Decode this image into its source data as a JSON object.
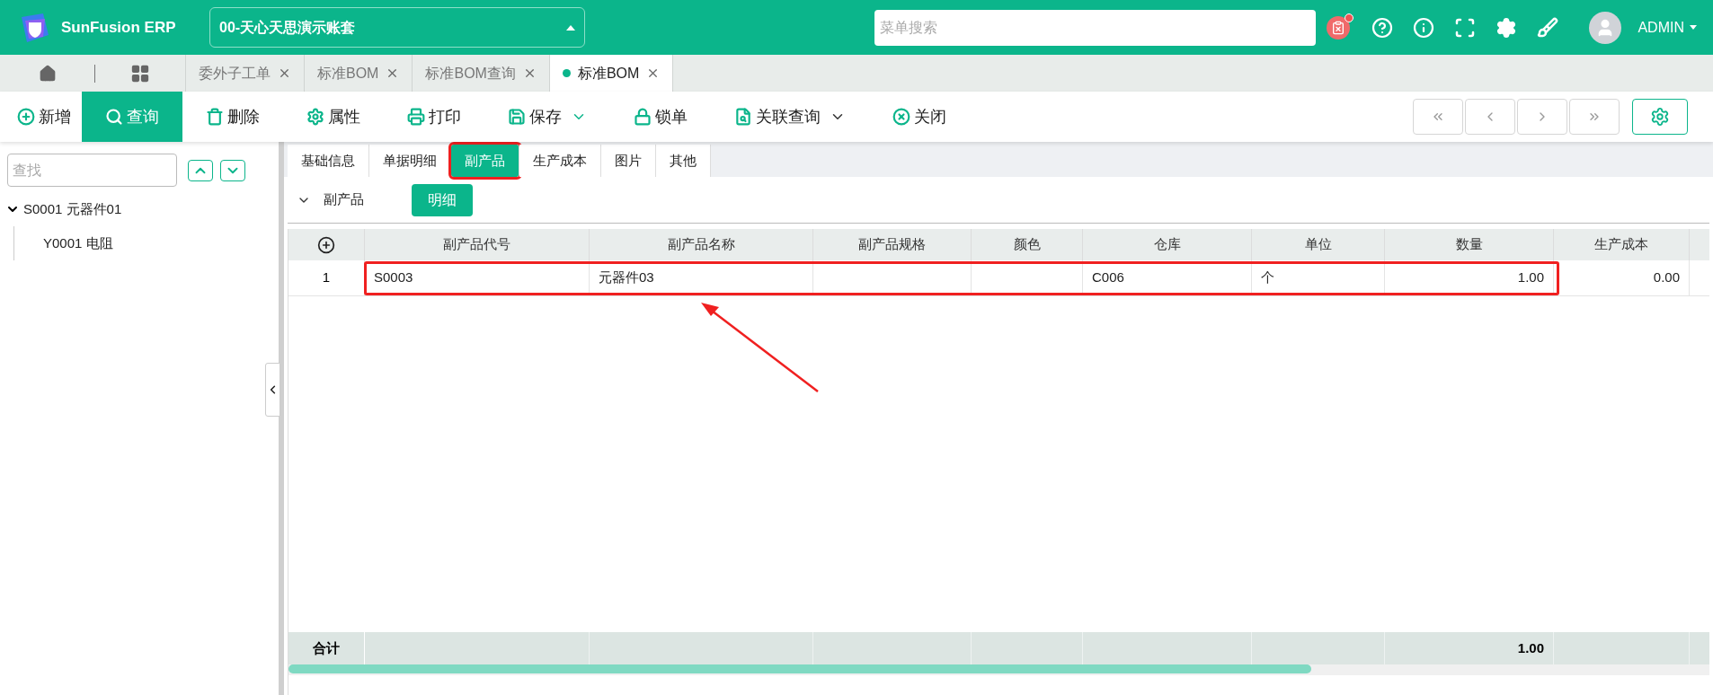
{
  "header": {
    "brand": "SunFusion ERP",
    "account": "00-天心天思演示账套",
    "search": {
      "placeholder": "菜单搜索"
    },
    "notification": true,
    "user": "ADMIN"
  },
  "open_tabs": [
    {
      "label": "委外子工单",
      "selected": false
    },
    {
      "label": "标准BOM",
      "selected": false
    },
    {
      "label": "标准BOM查询",
      "selected": false
    },
    {
      "label": "标准BOM",
      "selected": true
    }
  ],
  "toolbar": [
    {
      "label": "新增",
      "kind": "plus",
      "selected": false,
      "dropdown": false
    },
    {
      "label": "查询",
      "kind": "search",
      "selected": true,
      "dropdown": false
    },
    {
      "label": "删除",
      "kind": "trash",
      "selected": false,
      "dropdown": false
    },
    {
      "label": "属性",
      "kind": "gear",
      "selected": false,
      "dropdown": false
    },
    {
      "label": "打印",
      "kind": "printer",
      "selected": false,
      "dropdown": false
    },
    {
      "label": "保存",
      "kind": "save",
      "selected": false,
      "dropdown": true
    },
    {
      "label": "锁单",
      "kind": "lock",
      "selected": false,
      "dropdown": false
    },
    {
      "label": "关联查询",
      "kind": "docsearch",
      "selected": false,
      "dropdown": true
    },
    {
      "label": "关闭",
      "kind": "close",
      "selected": false,
      "dropdown": false
    }
  ],
  "sidebar": {
    "search": {
      "placeholder": "查找"
    },
    "tree": [
      {
        "label": "S0001 元器件01",
        "expanded": true,
        "children": [
          {
            "label": "Y0001 电阻"
          }
        ]
      }
    ]
  },
  "detail_tabs": [
    {
      "label": "基础信息",
      "selected": false,
      "highlighted": false
    },
    {
      "label": "单据明细",
      "selected": false,
      "highlighted": false
    },
    {
      "label": "副产品",
      "selected": true,
      "highlighted": true
    },
    {
      "label": "生产成本",
      "selected": false,
      "highlighted": false
    },
    {
      "label": "图片",
      "selected": false,
      "highlighted": false
    },
    {
      "label": "其他",
      "selected": false,
      "highlighted": false
    }
  ],
  "section": {
    "title": "副产品",
    "expanded": true,
    "button": "明细"
  },
  "table": {
    "columns": [
      "副产品代号",
      "副产品名称",
      "副产品规格",
      "颜色",
      "仓库",
      "单位",
      "数量",
      "生产成本"
    ],
    "rows": [
      {
        "index": "1",
        "cells": [
          "S0003",
          "元器件03",
          "",
          "",
          "C006",
          "个",
          "1.00",
          "0.00"
        ],
        "highlighted": true
      }
    ],
    "footer": {
      "label": "合计",
      "quantity_total": "1.00"
    },
    "scroll": {
      "level": 0.72
    }
  }
}
